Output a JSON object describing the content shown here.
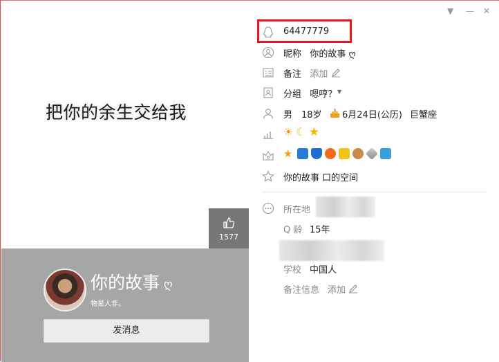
{
  "cover": {
    "text": "把你的余生交给我",
    "likes": "1577"
  },
  "profile": {
    "nickname": "你的故事",
    "nickname_symbol": "ღ",
    "signature": "物是人非。",
    "message_button": "发消息"
  },
  "window_controls": {
    "dropdown": "▼",
    "minimize": "—",
    "close": "✕"
  },
  "info": {
    "qq_number": "64477779",
    "nickname_label": "昵称",
    "nickname_value": "你的故事 ღ",
    "remark_label": "备注",
    "remark_value": "添加",
    "group_label": "分组",
    "group_value": "嗯哼？",
    "gender": "男",
    "age": "18岁",
    "birthday": "6月24日(公历)",
    "zodiac": "巨蟹座",
    "space": "你的故事 口的空间",
    "location_label": "所在地",
    "qage_label": "Q 龄",
    "qage_value": "15年",
    "school_label": "学校",
    "school_value": "中国人",
    "remark_info_label": "备注信息",
    "remark_info_value": "添加"
  }
}
